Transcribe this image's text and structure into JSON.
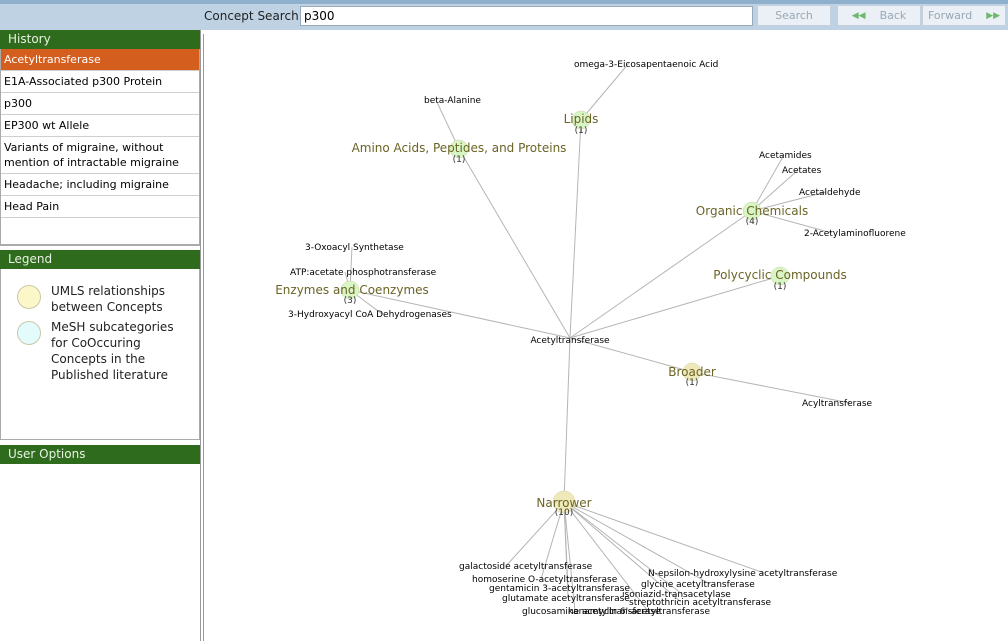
{
  "search": {
    "label": "Concept Search:",
    "value": "p300"
  },
  "buttons": {
    "search": "Search",
    "back": "Back",
    "forward": "Forward"
  },
  "history": {
    "title": "History",
    "items": [
      "Acetyltransferase",
      "E1A-Associated p300 Protein",
      "p300",
      "EP300 wt Allele",
      "Variants of migraine, without mention of intractable migraine",
      "Headache; including migraine",
      "Head Pain"
    ],
    "selected_index": 0
  },
  "legend": {
    "title": "Legend",
    "items": [
      {
        "text": "UMLS relationships between Concepts",
        "color": "#fbf7c8"
      },
      {
        "text": "MeSH subcategories for CoOccuring Concepts in the Published literature",
        "color": "#e3fbfb"
      }
    ]
  },
  "user_options": {
    "title": "User Options"
  },
  "graph": {
    "center": "Acetyltransferase",
    "colors": {
      "umls": "#efe9ba",
      "mesh": "#d8f5c4"
    },
    "categories": [
      {
        "label": "Lipids",
        "count": "(1)",
        "kind": "mesh",
        "leaves": [
          "omega-3-Eicosapentaenoic Acid"
        ]
      },
      {
        "label": "Amino Acids, Peptides, and Proteins",
        "count": "(1)",
        "kind": "mesh",
        "leaves": [
          "beta-Alanine"
        ]
      },
      {
        "label": "Organic Chemicals",
        "count": "(4)",
        "kind": "mesh",
        "leaves": [
          "Acetamides",
          "Acetates",
          "Acetaldehyde",
          "2-Acetylaminofluorene"
        ]
      },
      {
        "label": "Polycyclic Compounds",
        "count": "(1)",
        "kind": "mesh",
        "leaves": []
      },
      {
        "label": "Enzymes and Coenzymes",
        "count": "(3)",
        "kind": "mesh",
        "leaves": [
          "3-Oxoacyl Synthetase",
          "ATP:acetate phosphotransferase",
          "3-Hydroxyacyl CoA Dehydrogenases"
        ]
      },
      {
        "label": "Broader",
        "count": "(1)",
        "kind": "umls",
        "leaves": [
          "Acyltransferase"
        ]
      },
      {
        "label": "Narrower",
        "count": "(10)",
        "kind": "umls",
        "leaves": [
          "galactoside acetyltransferase",
          "homoserine O-acetyltransferase",
          "gentamicin 3-acetyltransferase",
          "glutamate acetyltransferase",
          "glucosamine acetyltransferase",
          "kanamycin 6'-acetyltransferase",
          "streptothricin acetyltransferase",
          "isoniazid-transacetylase",
          "glycine acetyltransferase",
          "N-epsilon-hydroxylysine acetyltransferase"
        ]
      }
    ]
  }
}
